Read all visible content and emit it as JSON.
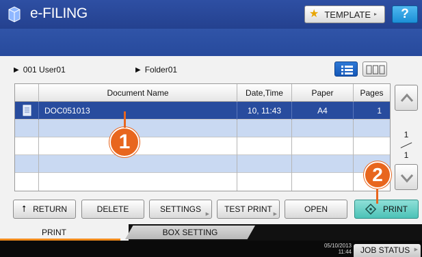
{
  "header": {
    "title": "e-FILING",
    "template_label": "TEMPLATE",
    "help_label": "?"
  },
  "path": {
    "box": "001 User01",
    "folder": "Folder01"
  },
  "table": {
    "columns": [
      "Document Name",
      "Date,Time",
      "Paper",
      "Pages"
    ],
    "rows": [
      {
        "name": "DOC051013",
        "datetime": "10, 11:43",
        "paper": "A4",
        "pages": "1",
        "selected": true
      }
    ]
  },
  "pager": {
    "current": "1",
    "total": "1"
  },
  "buttons": {
    "return": "RETURN",
    "delete": "DELETE",
    "settings": "SETTINGS",
    "test_print": "TEST PRINT",
    "open": "OPEN",
    "print": "PRINT"
  },
  "tabs": {
    "print": "PRINT",
    "box_setting": "BOX SETTING"
  },
  "status": {
    "date": "05/10/2013",
    "time": "11:44",
    "job_status": "JOB STATUS"
  },
  "callouts": {
    "one": "1",
    "two": "2"
  },
  "colors": {
    "title_bar": "#2e4fa3",
    "selected_row": "#284c9e",
    "alt_row": "#c9d9f2",
    "print_button": "#4cc2b7",
    "callout": "#e8661e",
    "tab_underline": "#f08a1c"
  }
}
